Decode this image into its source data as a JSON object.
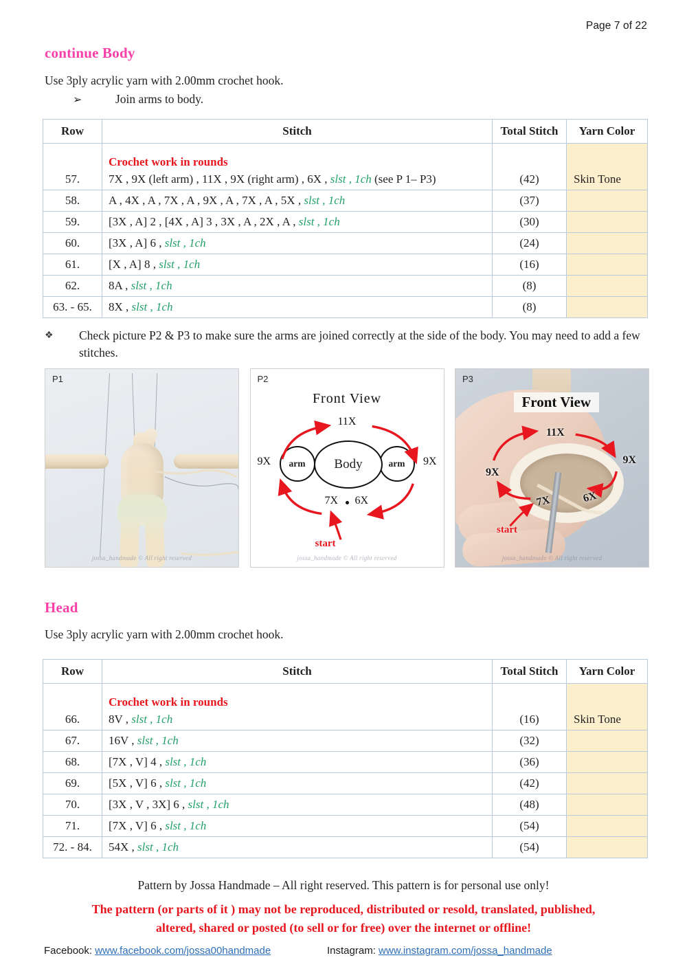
{
  "header": {
    "page_label": "Page 7 of 22"
  },
  "body_section": {
    "heading": "continue Body",
    "yarn_note": "Use 3ply acrylic yarn with 2.00mm crochet hook.",
    "bullet": {
      "arrow_icon": "arrow-right-icon",
      "text": "Join arms to body."
    },
    "table": {
      "columns": [
        "Row",
        "Stitch",
        "Total Stitch",
        "Yarn Color"
      ],
      "rounds_note": "Crochet work in rounds",
      "rows": [
        {
          "row": "57.",
          "stitch_plain_1": "7X , 9X (left arm) , 11X , 9X (right arm) , 6X , ",
          "stitch_green": "slst ,  1ch",
          "stitch_plain_2": " (see P 1– P3)",
          "total": "(42)",
          "yarn": "Skin Tone"
        },
        {
          "row": "58.",
          "stitch_plain_1": "A , 4X , A , 7X , A , 9X , A , 7X , A , 5X , ",
          "stitch_green": "slst ,  1ch",
          "stitch_plain_2": "",
          "total": "(37)",
          "yarn": ""
        },
        {
          "row": "59.",
          "stitch_plain_1": "[3X , A] 2 , [4X , A] 3 , 3X , A , 2X , A , ",
          "stitch_green": "slst ,  1ch",
          "stitch_plain_2": "",
          "total": "(30)",
          "yarn": ""
        },
        {
          "row": "60.",
          "stitch_plain_1": "[3X , A] 6 , ",
          "stitch_green": "slst ,  1ch",
          "stitch_plain_2": "",
          "total": "(24)",
          "yarn": ""
        },
        {
          "row": "61.",
          "stitch_plain_1": "[X , A] 8 , ",
          "stitch_green": "slst ,  1ch",
          "stitch_plain_2": "",
          "total": "(16)",
          "yarn": ""
        },
        {
          "row": "62.",
          "stitch_plain_1": "8A , ",
          "stitch_green": "slst ,  1ch",
          "stitch_plain_2": "",
          "total": "(8)",
          "yarn": ""
        },
        {
          "row": "63. - 65.",
          "stitch_plain_1": "8X , ",
          "stitch_green": "slst ,  1ch",
          "stitch_plain_2": "",
          "total": "(8)",
          "yarn": ""
        }
      ]
    }
  },
  "check_note": {
    "bullet_icon": "diamond-bullet-icon",
    "text": "Check picture P2 & P3 to make sure the arms are joined correctly at the side of the body. You may need to add a few stitches."
  },
  "pictures": [
    {
      "label": "P1",
      "watermark": "jossa_handmade © All right reserved",
      "kind": "photo-body-with-arms"
    },
    {
      "label": "P2",
      "title": "Front View",
      "watermark": "jossa_handmade © All right reserved",
      "kind": "diagram",
      "body_label": "Body",
      "arm_left_label": "arm",
      "arm_right_label": "arm",
      "top_label": "11X",
      "left_label": "9X",
      "right_label": "9X",
      "bottom_left_label": "7X",
      "bottom_right_label": "6X",
      "start_label": "start"
    },
    {
      "label": "P3",
      "title": "Front View",
      "watermark": "jossa_handmade © All right reserved",
      "kind": "photo-diagram",
      "top_label": "11X",
      "left_label": "9X",
      "right_label": "9X",
      "bottom_left_label": "7X",
      "bottom_right_label": "6X",
      "start_label": "start"
    }
  ],
  "head_section": {
    "heading": "Head",
    "yarn_note": "Use 3ply acrylic yarn with 2.00mm crochet hook.",
    "table": {
      "columns": [
        "Row",
        "Stitch",
        "Total Stitch",
        "Yarn Color"
      ],
      "rounds_note": "Crochet work in rounds",
      "rows": [
        {
          "row": "66.",
          "stitch_plain_1": "8V , ",
          "stitch_green": "slst ,  1ch",
          "stitch_plain_2": "",
          "total": "(16)",
          "yarn": "Skin Tone"
        },
        {
          "row": "67.",
          "stitch_plain_1": "16V , ",
          "stitch_green": "slst ,  1ch",
          "stitch_plain_2": "",
          "total": "(32)",
          "yarn": ""
        },
        {
          "row": "68.",
          "stitch_plain_1": "[7X , V] 4 , ",
          "stitch_green": "slst ,  1ch",
          "stitch_plain_2": "",
          "total": "(36)",
          "yarn": ""
        },
        {
          "row": "69.",
          "stitch_plain_1": "[5X , V] 6 , ",
          "stitch_green": "slst ,  1ch",
          "stitch_plain_2": "",
          "total": "(42)",
          "yarn": ""
        },
        {
          "row": "70.",
          "stitch_plain_1": "[3X , V , 3X] 6 , ",
          "stitch_green": "slst ,  1ch",
          "stitch_plain_2": "",
          "total": "(48)",
          "yarn": ""
        },
        {
          "row": "71.",
          "stitch_plain_1": "[7X , V] 6 , ",
          "stitch_green": "slst ,  1ch",
          "stitch_plain_2": "",
          "total": "(54)",
          "yarn": ""
        },
        {
          "row": "72. - 84.",
          "stitch_plain_1": "54X , ",
          "stitch_green": "slst ,  1ch",
          "stitch_plain_2": "",
          "total": "(54)",
          "yarn": ""
        }
      ]
    }
  },
  "footer": {
    "line1": "Pattern by Jossa Handmade – All right reserved. This pattern is for personal use only!",
    "warning_line1": "The pattern (or parts of it ) may not be reproduced, distributed or resold, translated, published,",
    "warning_line2": "altered, shared or posted (to sell or for free) over the internet or offline!",
    "facebook_label": "Facebook:",
    "facebook_url": "www.facebook.com/jossa00handmade",
    "instagram_label": "Instagram:",
    "instagram_url": "www.instagram.com/jossa_handmade"
  },
  "colors": {
    "heading_pink": "#fb3fa9",
    "rounds_red": "#e8161e",
    "stitch_green": "#23a06a",
    "yarn_cell": "#fcefcd",
    "table_border": "#b9cade",
    "link_blue": "#2e6fb7",
    "arrow_red": "#e8161e"
  }
}
